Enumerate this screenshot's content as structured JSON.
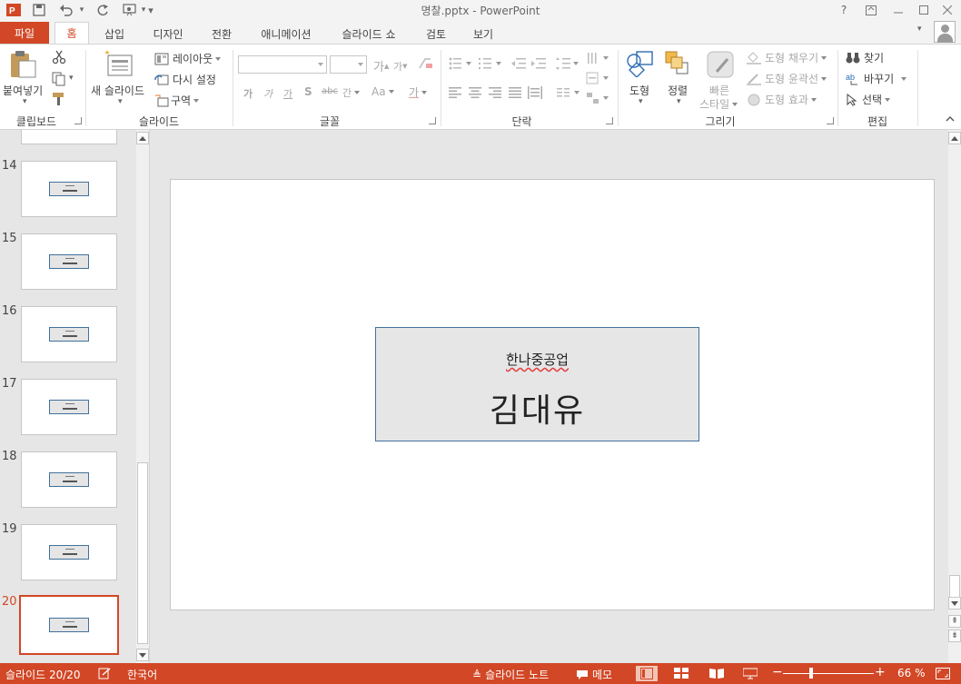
{
  "app": {
    "title": "명찰.pptx - PowerPoint",
    "brand_color": "#d24726",
    "quick_access": [
      "save-icon",
      "undo-icon",
      "redo-icon",
      "slideshow-from-start-icon",
      "customize-icon"
    ],
    "window_controls": {
      "help": "?",
      "ribbon_display": "ribbon-display-icon",
      "minimize": "minimize-icon",
      "maximize": "maximize-icon",
      "close": "close-icon"
    }
  },
  "tabs": {
    "file": "파일",
    "items": [
      "홈",
      "삽입",
      "디자인",
      "전환",
      "애니메이션",
      "슬라이드 쇼",
      "검토",
      "보기"
    ],
    "active": "홈"
  },
  "ribbon": {
    "clipboard": {
      "label": "클립보드",
      "paste": "붙여넣기"
    },
    "slides": {
      "label": "슬라이드",
      "new_slide": "새 슬라이드",
      "layout": "레이아웃",
      "reset": "다시 설정",
      "section": "구역"
    },
    "font": {
      "label": "글꼴",
      "font_name": "",
      "font_size": "",
      "grow": "가",
      "shrink": "가",
      "bold": "가",
      "italic": "가",
      "underline": "가",
      "shadow": "S",
      "strike": "abc",
      "spacing": "간",
      "case": "Aa",
      "color": "가"
    },
    "paragraph": {
      "label": "단락"
    },
    "drawing": {
      "label": "그리기",
      "shapes": "도형",
      "arrange": "정렬",
      "quick_styles_1": "빠른",
      "quick_styles_2": "스타일",
      "fill": "도형 채우기",
      "outline": "도형 윤곽선",
      "effects": "도형 효과"
    },
    "editing": {
      "label": "편집",
      "find": "찾기",
      "replace": "바꾸기",
      "select": "선택"
    }
  },
  "thumbnails": {
    "items": [
      {
        "number": "14",
        "active": false
      },
      {
        "number": "15",
        "active": false
      },
      {
        "number": "16",
        "active": false
      },
      {
        "number": "17",
        "active": false
      },
      {
        "number": "18",
        "active": false
      },
      {
        "number": "19",
        "active": false
      },
      {
        "number": "20",
        "active": true
      }
    ]
  },
  "slide": {
    "company": "한나중공업",
    "name": "김대유"
  },
  "status": {
    "slide_info": "슬라이드 20/20",
    "language": "한국어",
    "notes": "슬라이드 노트",
    "comments": "메모",
    "zoom_text": "66 %",
    "zoom_percent": 66
  }
}
